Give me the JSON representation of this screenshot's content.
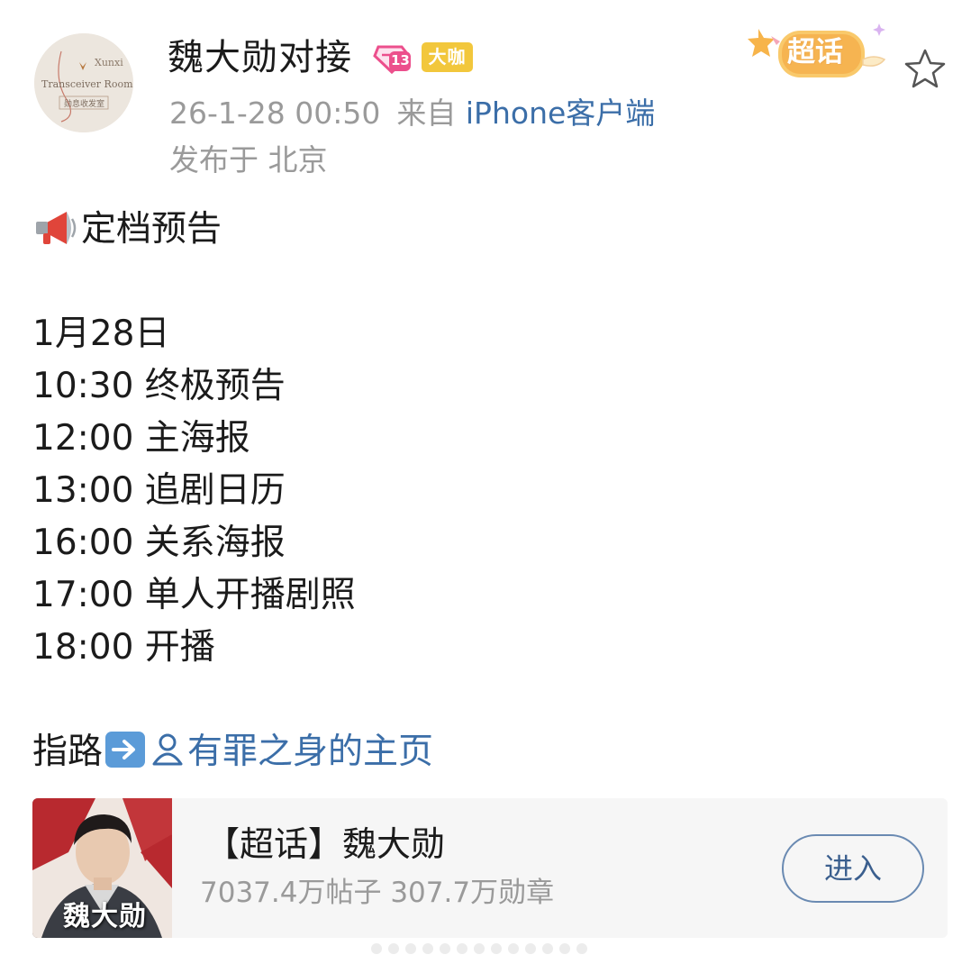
{
  "header": {
    "user_name": "魏大勋对接",
    "level_badge": "13",
    "vip_badge": "大咖",
    "supertopic_tag": "超话",
    "timestamp": "26-1-28 00:50",
    "source_prefix": "来自",
    "source_client": "iPhone客户端",
    "location": "发布于 北京",
    "avatar_text": {
      "line1": "Xunxi",
      "line2": "Transceiver Room",
      "line3": "勋息收发室"
    }
  },
  "post": {
    "headline": "定档预告",
    "date": "1月28日",
    "schedule": [
      "10:30 终极预告",
      "12:00 主海报",
      "13:00 追剧日历",
      "16:00 关系海报",
      "17:00 单人开播剧照",
      "18:00 开播"
    ],
    "pointer_label": "指路",
    "pointer_link": "有罪之身的主页"
  },
  "card": {
    "title": "【超话】魏大勋",
    "stats": "7037.4万帖子 307.7万勋章",
    "thumb_caption": "魏大勋",
    "enter_label": "进入"
  },
  "colors": {
    "link": "#3b6ea8",
    "meta_gray": "#9a9a9a",
    "vip_badge": "#f2c73c",
    "level_badge": "#ec4f8c",
    "card_bg": "#f6f6f6"
  },
  "icons": {
    "megaphone": "megaphone-icon",
    "arrow": "right-arrow-icon",
    "user": "user-icon",
    "star": "star-icon"
  }
}
